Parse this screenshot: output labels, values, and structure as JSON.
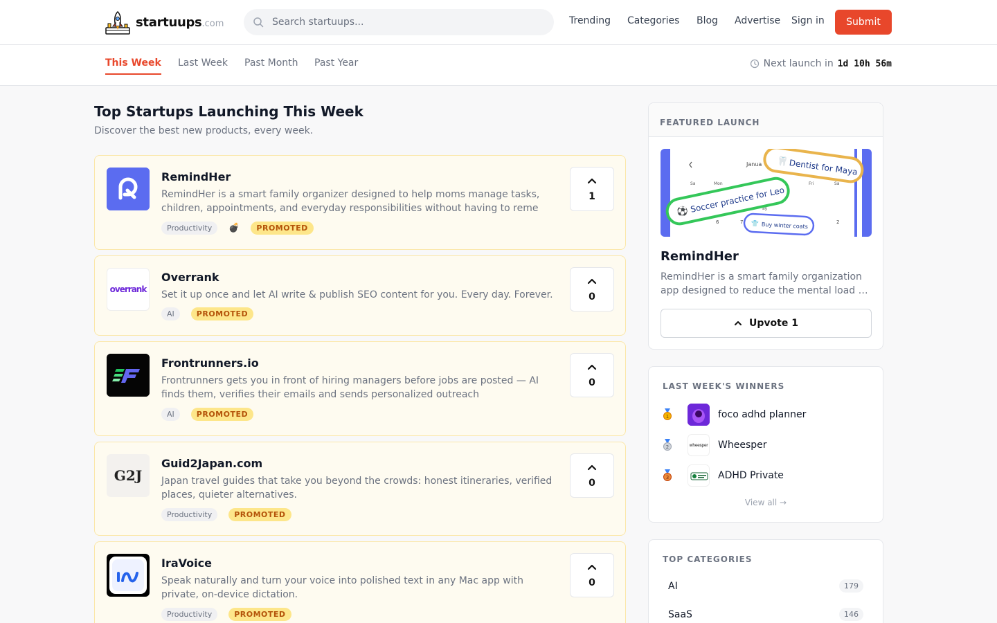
{
  "header": {
    "logo_text": "startuups",
    "logo_tld": ".com",
    "search_placeholder": "Search startuups...",
    "nav": [
      "Trending",
      "Categories",
      "Blog",
      "Advertise"
    ],
    "sign_in": "Sign in",
    "submit": "Submit"
  },
  "subnav": {
    "tabs": [
      "This Week",
      "Last Week",
      "Past Month",
      "Past Year"
    ],
    "active_tab": "This Week",
    "countdown_label": "Next launch in",
    "countdown_time": "1d 10h 56m"
  },
  "main": {
    "title": "Top Startups Launching This Week",
    "subtitle": "Discover the best new products, every week.",
    "products": [
      {
        "name": "RemindHer",
        "description": "RemindHer is a smart family organizer designed to help moms manage tasks, children, appointments, and everyday responsibilities without having to reme",
        "tag": "Productivity",
        "promo": "PROMOTED",
        "votes": "1"
      },
      {
        "name": "Overrank",
        "description": "Set it up once and let AI write & publish SEO content for you. Every day. Forever.",
        "tag": "AI",
        "promo": "PROMOTED",
        "votes": "0",
        "logo_text": "overrank"
      },
      {
        "name": "Frontrunners.io",
        "description": "Frontrunners gets you in front of hiring managers before jobs are posted — AI finds them, verifies their emails and sends personalized outreach",
        "tag": "AI",
        "promo": "PROMOTED",
        "votes": "0"
      },
      {
        "name": "Guid2Japan.com",
        "description": "Japan travel guides that take you beyond the crowds: honest itineraries, verified places, quieter alternatives.",
        "tag": "Productivity",
        "promo": "PROMOTED",
        "votes": "0",
        "logo_text": "G2J"
      },
      {
        "name": "IraVoice",
        "description": "Speak naturally and turn your voice into polished text in any Mac app with private, on-device dictation.",
        "tag": "Productivity",
        "promo": "PROMOTED",
        "votes": "0"
      }
    ]
  },
  "featured": {
    "heading": "FEATURED LAUNCH",
    "name": "RemindHer",
    "description": "RemindHer is a smart family organization app designed to reduce the mental load …",
    "upvote_label": "Upvote 1",
    "image_pills": [
      "Dentist for Maya",
      "Soccer practice for Leo",
      "Buy winter coats"
    ],
    "image_calendar": {
      "month": "Janua",
      "days": [
        "Sa",
        "Mon",
        "Fri",
        "Sa"
      ],
      "numbers": [
        "6",
        "7",
        "2"
      ],
      "day_partial": "ay"
    }
  },
  "winners": {
    "heading": "LAST WEEK'S WINNERS",
    "items": [
      {
        "name": "foco adhd planner",
        "medal": "gold"
      },
      {
        "name": "Wheesper",
        "medal": "silver",
        "logo_text": "wheesper"
      },
      {
        "name": "ADHD Private",
        "medal": "bronze"
      }
    ],
    "view_all": "View all →"
  },
  "categories": {
    "heading": "TOP CATEGORIES",
    "items": [
      {
        "name": "AI",
        "count": "179"
      },
      {
        "name": "SaaS",
        "count": "146"
      }
    ]
  },
  "colors": {
    "accent": "#e8472b",
    "promo_bg": "#fde68a",
    "card_bg": "#fefbf0"
  }
}
